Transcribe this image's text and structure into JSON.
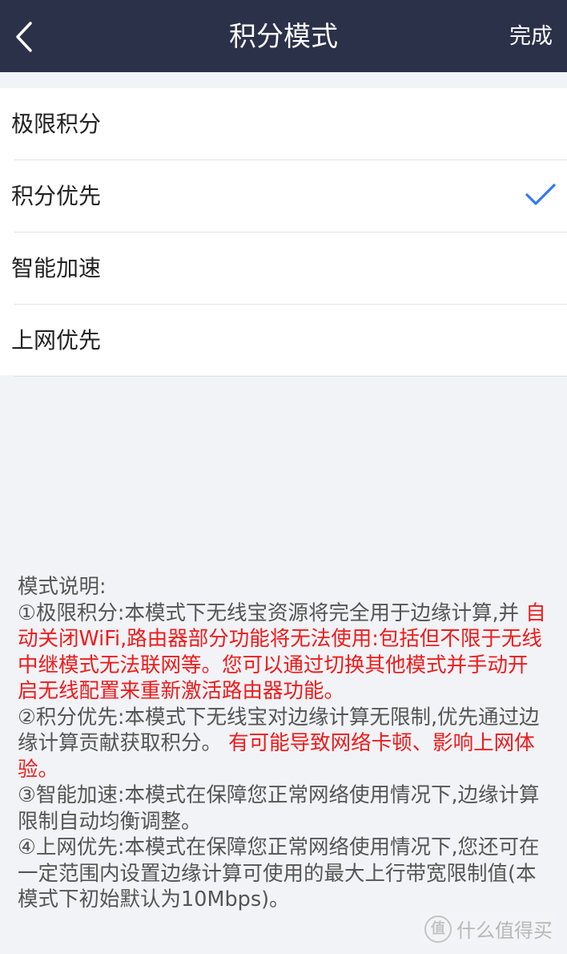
{
  "header": {
    "title": "积分模式",
    "done_label": "完成",
    "back_icon": "chevron-left-icon",
    "background": "#2b3149"
  },
  "modes": [
    {
      "label": "极限积分",
      "selected": false
    },
    {
      "label": "积分优先",
      "selected": true
    },
    {
      "label": "智能加速",
      "selected": false
    },
    {
      "label": "上网优先",
      "selected": false
    }
  ],
  "accent_color": "#3478f6",
  "warning_color": "#ee1b1b",
  "description": {
    "heading": "模式说明:",
    "items": [
      {
        "title": "①极限积分:",
        "text": "本模式下无线宝资源将完全用于边缘计算,并",
        "warning": "自动关闭WiFi,路由器部分功能将无法使用:包括但不限于无线中继模式无法联网等。您可以通过切换其他模式并手动开启无线配置来重新激活路由器功能。"
      },
      {
        "title": "②积分优先:",
        "text": "本模式下无线宝对边缘计算无限制,优先通过边缘计算贡献获取积分。",
        "warning": "有可能导致网络卡顿、影响上网体验。"
      },
      {
        "title": "③智能加速:",
        "text": "本模式在保障您正常网络使用情况下,边缘计算限制自动均衡调整。",
        "warning": ""
      },
      {
        "title": "④上网优先:",
        "text": "本模式在保障您正常网络使用情况下,您还可在一定范围内设置边缘计算可使用的最大上行带宽限制值(本模式下初始默认为10Mbps)。",
        "warning": ""
      }
    ]
  },
  "watermark": {
    "logo": "值",
    "text": "什么值得买"
  }
}
